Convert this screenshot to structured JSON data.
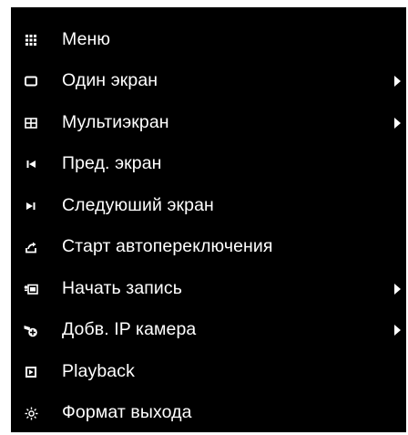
{
  "menu": {
    "items": [
      {
        "label": "Меню",
        "icon": "grid-icon",
        "submenu": false
      },
      {
        "label": "Один экран",
        "icon": "single-screen-icon",
        "submenu": true
      },
      {
        "label": "Мультиэкран",
        "icon": "multi-screen-icon",
        "submenu": true
      },
      {
        "label": "Пред. экран",
        "icon": "previous-screen-icon",
        "submenu": false
      },
      {
        "label": "Следуюший экран",
        "icon": "next-screen-icon",
        "submenu": false
      },
      {
        "label": "Старт автопереключения",
        "icon": "auto-switch-icon",
        "submenu": false
      },
      {
        "label": "Начать запись",
        "icon": "record-icon",
        "submenu": true
      },
      {
        "label": "Добв. IP камера",
        "icon": "add-ip-camera-icon",
        "submenu": true
      },
      {
        "label": "Playback",
        "icon": "playback-icon",
        "submenu": false
      },
      {
        "label": "Формат выхода",
        "icon": "output-format-icon",
        "submenu": false
      }
    ]
  },
  "colors": {
    "background": "#000000",
    "text": "#ffffff"
  }
}
